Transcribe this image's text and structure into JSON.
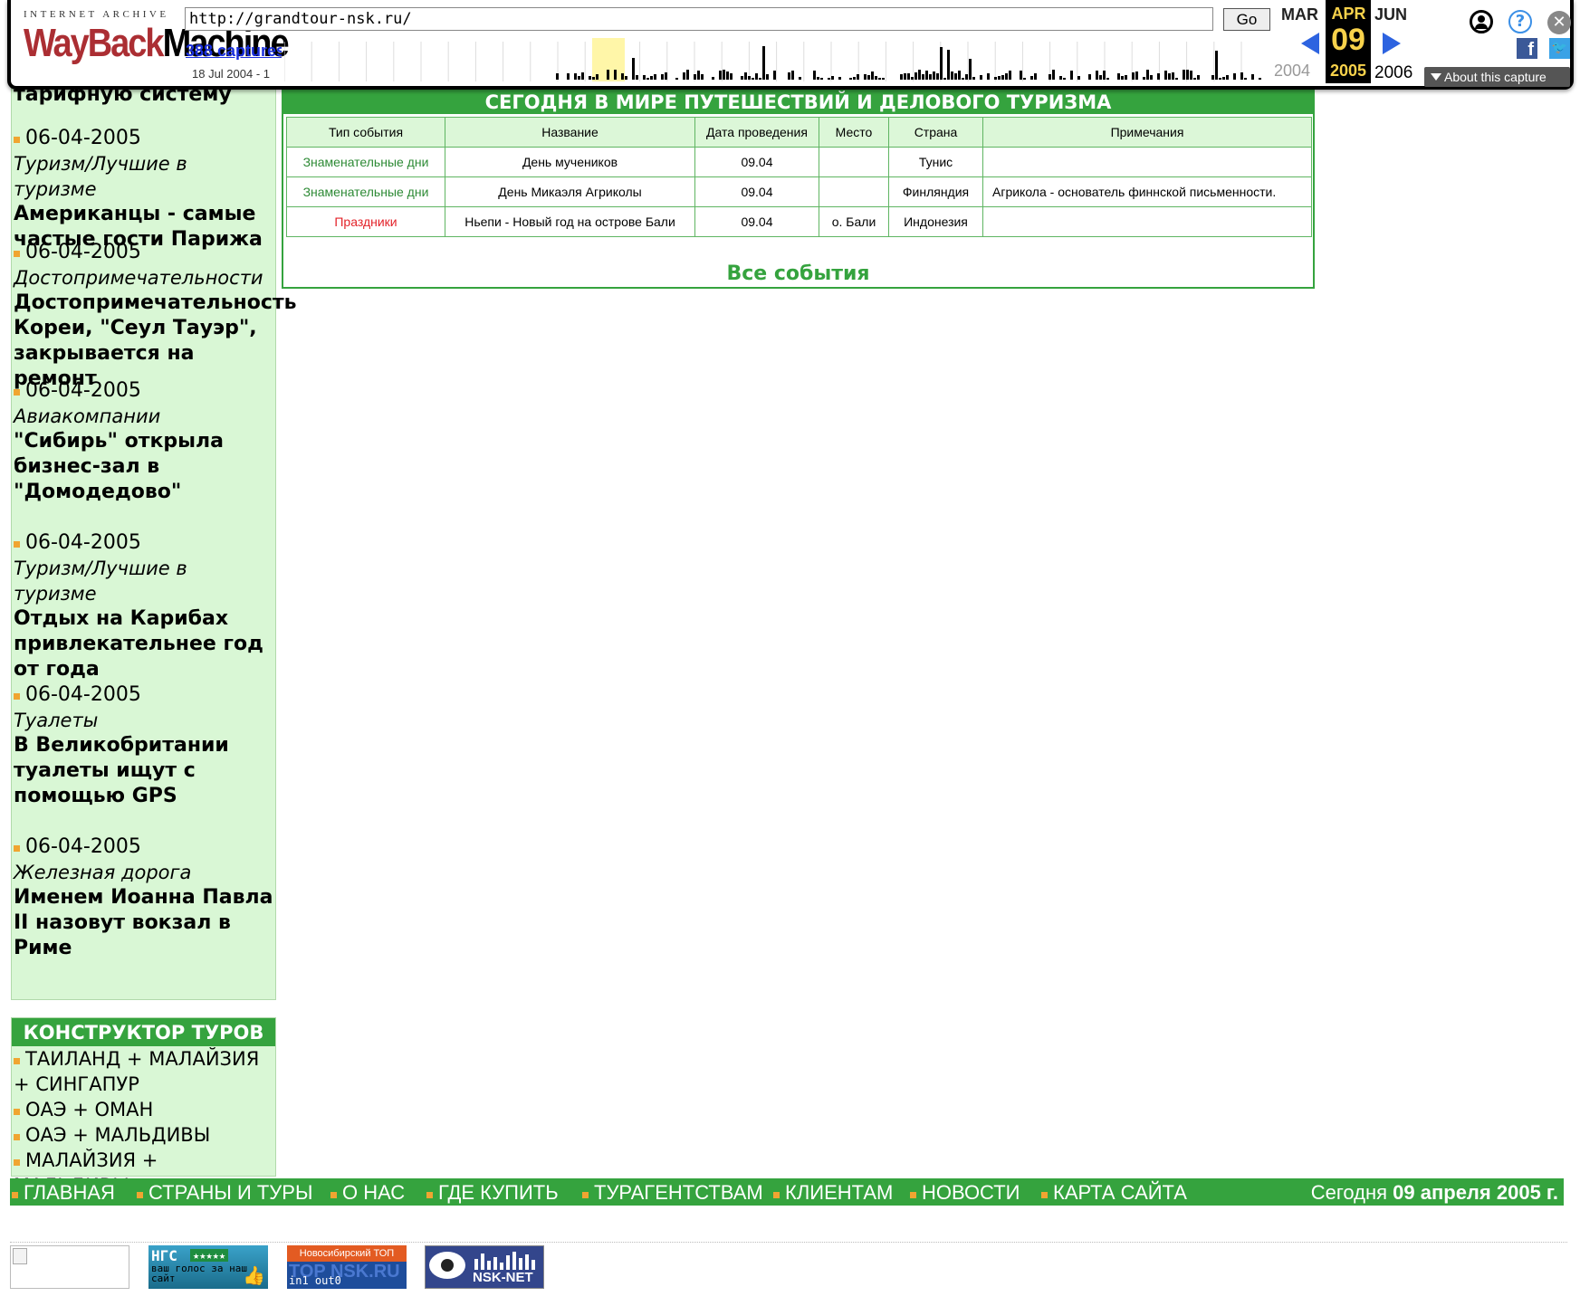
{
  "wayback": {
    "logo_top": "INTERNET ARCHIVE",
    "logo_way": "WayBack",
    "logo_machine": "Machine",
    "url": "http://grandtour-nsk.ru/",
    "go_label": "Go",
    "captures_link": "388 captures",
    "date_range": "18 Jul 2004 - 1",
    "prev_month": "MAR",
    "cur_month": "APR",
    "next_month": "JUN",
    "cur_day": "09",
    "prev_year": "2004",
    "cur_year": "2005",
    "next_year": "2006",
    "about_label": "About this capture",
    "help_glyph": "?",
    "close_glyph": "✕",
    "fb_glyph": "f",
    "tw_glyph": "🐦"
  },
  "news": {
    "partial_top": "тарифную систему",
    "items": [
      {
        "date": "06-04-2005",
        "category": "Туризм/Лучшие в туризме",
        "title": "Американцы - самые частые гости Парижа"
      },
      {
        "date": "06-04-2005",
        "category": "Достопримечательности",
        "title": "Достопримечательность Кореи, \"Сеул Тауэр\", закрывается на ремонт"
      },
      {
        "date": "06-04-2005",
        "category": "Авиакомпании",
        "title": "\"Сибирь\" открыла бизнес-зал в \"Домодедово\""
      },
      {
        "date": "06-04-2005",
        "category": "Туризм/Лучшие в туризме",
        "title": "Отдых на Карибах привлекательнее год от года"
      },
      {
        "date": "06-04-2005",
        "category": "Туалеты",
        "title": "В Великобритании туалеты ищут с помощью GPS"
      },
      {
        "date": "06-04-2005",
        "category": "Железная дорога",
        "title": "Именем Иоанна Павла II назовут вокзал в Риме"
      }
    ]
  },
  "constructor": {
    "title": "КОНСТРУКТОР ТУРОВ",
    "items": [
      "ТАИЛАНД + МАЛАЙЗИЯ + СИНГАПУР",
      "ОАЭ + ОМАН",
      "ОАЭ + МАЛЬДИВЫ",
      "МАЛАЙЗИЯ + МАЛЬДИВЫ"
    ]
  },
  "events": {
    "title": "СЕГОДНЯ В МИРЕ ПУТЕШЕСТВИЙ И ДЕЛОВОГО ТУРИЗМА",
    "columns": [
      "Тип события",
      "Название",
      "Дата проведения",
      "Место",
      "Страна",
      "Примечания"
    ],
    "rows": [
      {
        "type": "Знаменательные дни",
        "name": "День мучеников",
        "date": "09.04",
        "place": "",
        "country": "Тунис",
        "note": "",
        "type_color": "green"
      },
      {
        "type": "Знаменательные дни",
        "name": "День Микаэля Агриколы",
        "date": "09.04",
        "place": "",
        "country": "Финляндия",
        "note": "Агрикола - основатель финнской письменности.",
        "type_color": "green"
      },
      {
        "type": "Праздники",
        "name": "Ньепи - Новый год на острове Бали",
        "date": "09.04",
        "place": "о. Бали",
        "country": "Индонезия",
        "note": "",
        "type_color": "red"
      }
    ],
    "all_link": "Все события"
  },
  "bottom_nav": {
    "items": [
      "ГЛАВНАЯ",
      "СТРАНЫ И ТУРЫ",
      "О НАС",
      "ГДЕ КУПИТЬ",
      "ТУРАГЕНТСТВАМ",
      "КЛИЕНТАМ",
      "НОВОСТИ",
      "КАРТА САЙТА"
    ],
    "today_prefix": "Сегодня",
    "today_date": "09 апреля 2005 г."
  },
  "banners": {
    "ngs_title": "НГС",
    "ngs_stars": "★★★★★",
    "ngs_text": "ваш голос за наш сайт",
    "top_title": "Новосибирский ТОП",
    "top_logo": "TOP NSK.RU",
    "top_stats": "in1 out0",
    "nsk_label": "NSK-NET"
  },
  "colors": {
    "green": "#35a33e",
    "light_green": "#d9f7d5",
    "bullet": "#f0a531",
    "red": "#e3232a"
  }
}
